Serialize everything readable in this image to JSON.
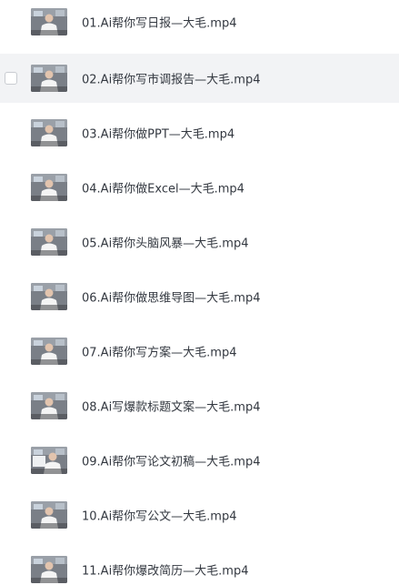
{
  "files": [
    {
      "name": "01.Ai帮你写日报—大毛.mp4",
      "thumbnail_icon": "video-thumbnail-icon"
    },
    {
      "name": "02.Ai帮你写市调报告—大毛.mp4",
      "thumbnail_icon": "video-thumbnail-icon",
      "hovered": true
    },
    {
      "name": "03.Ai帮你做PPT—大毛.mp4",
      "thumbnail_icon": "video-thumbnail-icon"
    },
    {
      "name": "04.Ai帮你做Excel—大毛.mp4",
      "thumbnail_icon": "video-thumbnail-icon"
    },
    {
      "name": "05.Ai帮你头脑风暴—大毛.mp4",
      "thumbnail_icon": "video-thumbnail-icon"
    },
    {
      "name": "06.Ai帮你做思维导图—大毛.mp4",
      "thumbnail_icon": "video-thumbnail-icon"
    },
    {
      "name": "07.Ai帮你写方案—大毛.mp4",
      "thumbnail_icon": "video-thumbnail-icon"
    },
    {
      "name": "08.Ai写爆款标题文案—大毛.mp4",
      "thumbnail_icon": "video-thumbnail-icon"
    },
    {
      "name": "09.Ai帮你写论文初稿—大毛.mp4",
      "thumbnail_icon": "video-thumbnail-icon"
    },
    {
      "name": "10.Ai帮你写公文—大毛.mp4",
      "thumbnail_icon": "video-thumbnail-icon"
    },
    {
      "name": "11.Ai帮你爆改简历—大毛.mp4",
      "thumbnail_icon": "video-thumbnail-icon"
    }
  ],
  "colors": {
    "hover_background": "#f2f3f5",
    "text": "#333840",
    "checkbox_border": "#c9ccd1"
  }
}
